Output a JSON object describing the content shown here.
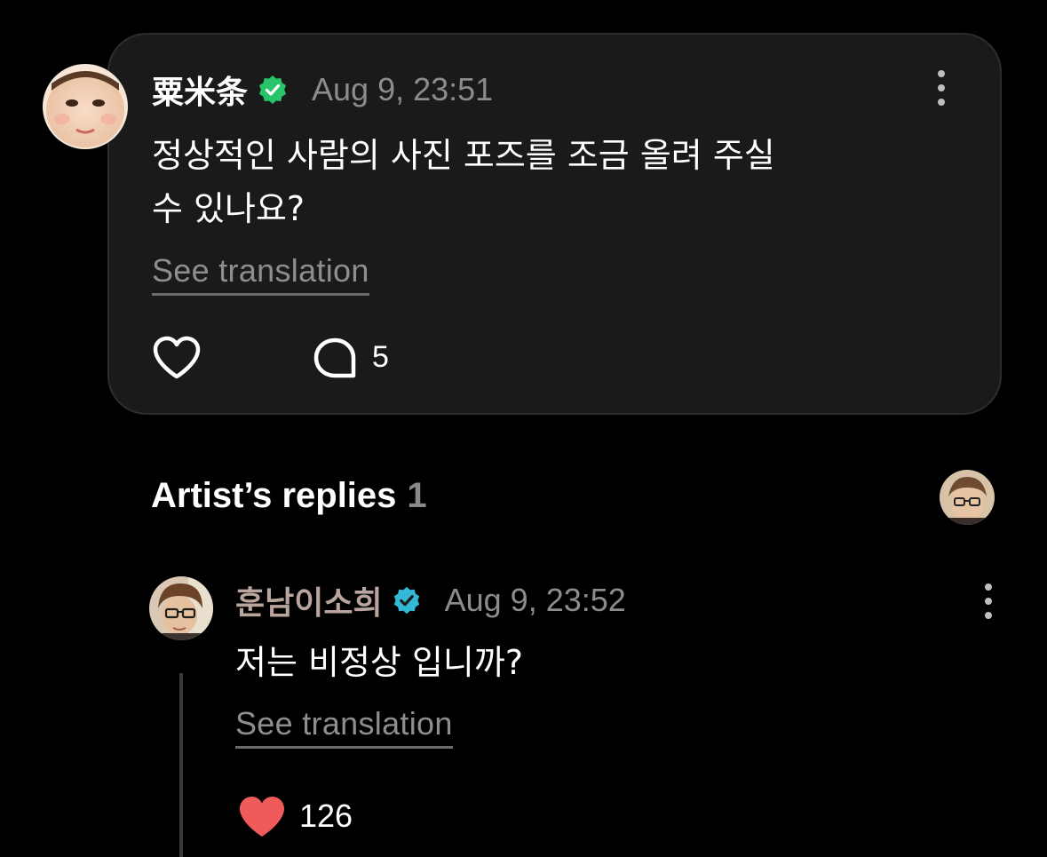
{
  "post": {
    "author": "粟米条",
    "timestamp": "Aug 9, 23:51",
    "text_line1": "정상적인 사람의 사진 포즈를 조금 올려 주실",
    "text_line2": "수 있나요?",
    "see_translation": "See translation",
    "comment_count": "5",
    "liked": false
  },
  "artist_replies": {
    "title": "Artist’s replies",
    "count": "1"
  },
  "reply": {
    "author": "훈남이소희",
    "timestamp": "Aug 9, 23:52",
    "text": "저는 비정상 입니까?",
    "see_translation": "See translation",
    "like_count": "126",
    "liked": true
  },
  "colors": {
    "background": "#000000",
    "card": "#1a1a1a",
    "muted_text": "#8c8c8c",
    "verified_green": "#27c46b",
    "verified_teal": "#33b8d6",
    "heart_red": "#f05a5a",
    "reply_author": "#b9a59d"
  },
  "icons": {
    "post_verified": "verified-badge-icon",
    "reply_verified": "verified-badge-icon",
    "more": "more-vertical-icon",
    "like": "heart-outline-icon",
    "comment": "speech-bubble-icon",
    "reply_like": "heart-filled-icon"
  }
}
